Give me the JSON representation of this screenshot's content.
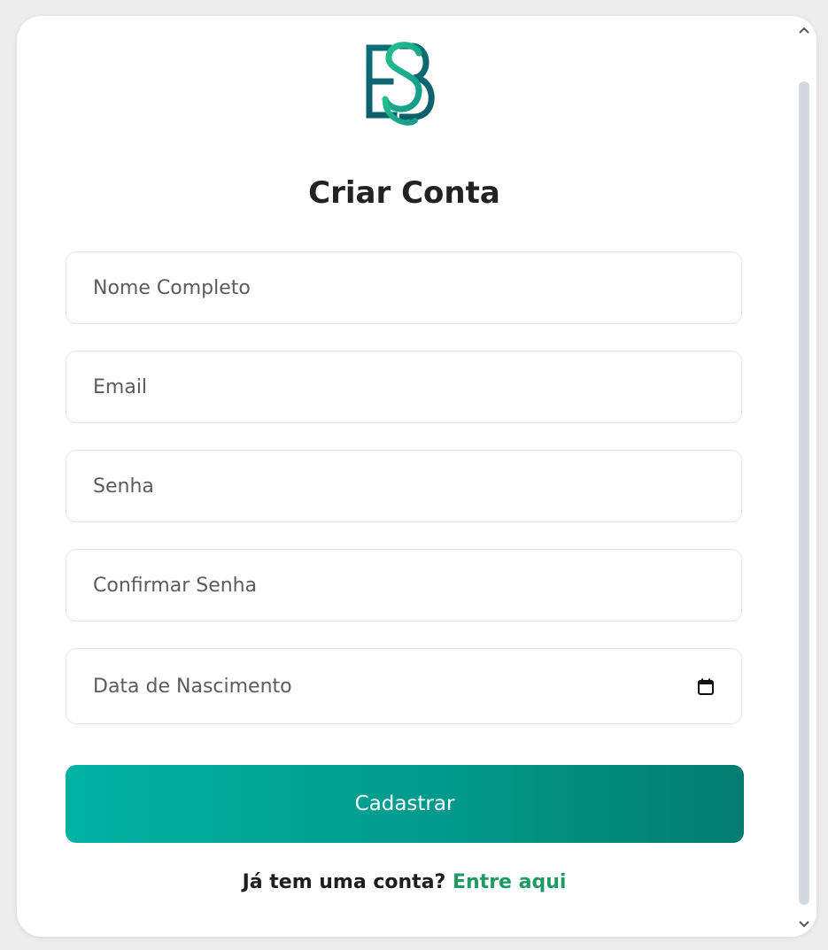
{
  "form": {
    "title": "Criar Conta",
    "fields": [
      {
        "name": "Nome Completo",
        "placeholder": "Nome Completo",
        "value": ""
      },
      {
        "name": "Email",
        "placeholder": "Email",
        "value": ""
      },
      {
        "name": "Senha",
        "placeholder": "Senha",
        "value": ""
      },
      {
        "name": "Confirmar Senha",
        "placeholder": "Confirmar Senha",
        "value": ""
      },
      {
        "name": "Data de Nascimento",
        "placeholder": "Data de Nascimento",
        "value": ""
      }
    ],
    "submit_label": "Cadastrar",
    "login_prompt": "Já tem uma conta?",
    "login_link": "Entre aqui"
  },
  "icons": {
    "logo": "bs-monogram-logo",
    "date": "calendar-icon",
    "scroll_up": "chevron-up-icon",
    "scroll_down": "chevron-down-icon"
  },
  "colors": {
    "accent_start": "#01b2a2",
    "accent_end": "#037c6f",
    "link": "#1f9a62",
    "logo_dark": "#0b6e78",
    "logo_light": "#1fb98a"
  }
}
